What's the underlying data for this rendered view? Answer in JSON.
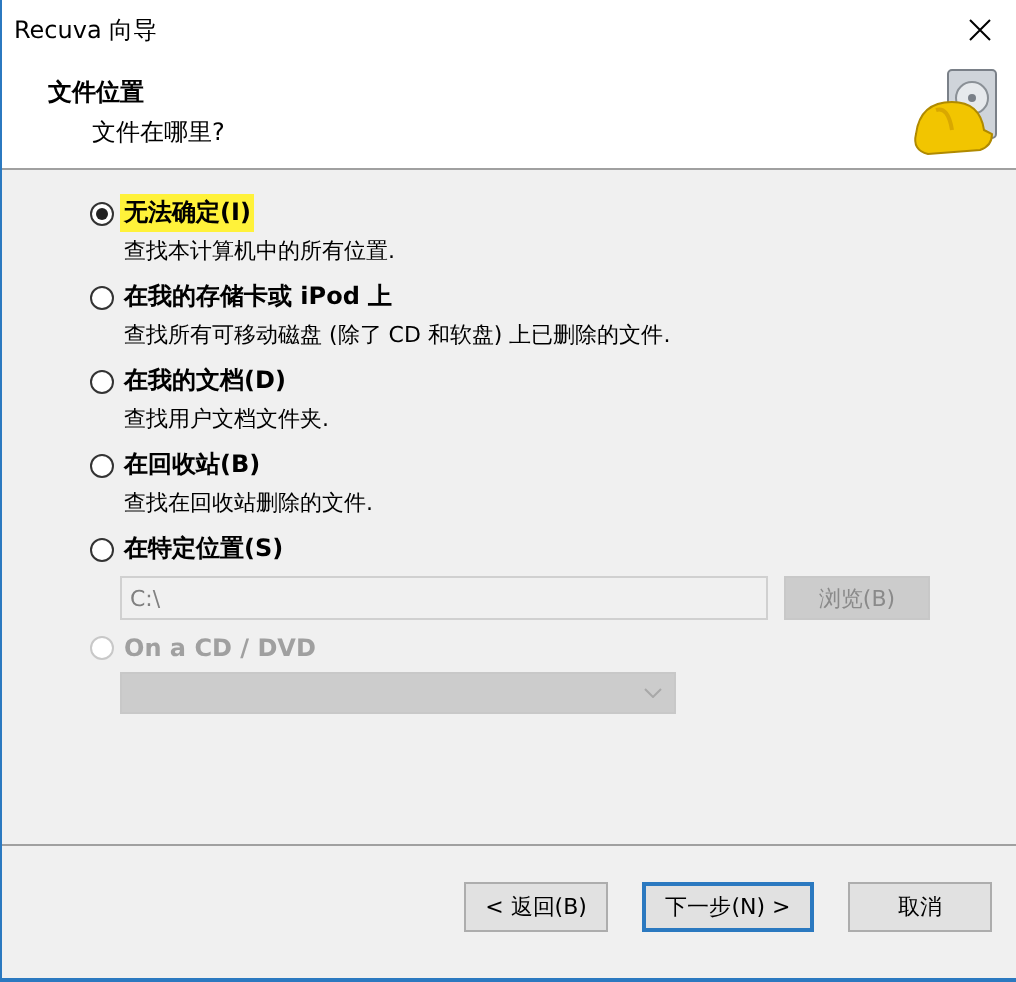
{
  "window": {
    "title": "Recuva 向导"
  },
  "header": {
    "title": "文件位置",
    "subtitle": "文件在哪里?"
  },
  "options": [
    {
      "label": "无法确定(I)",
      "description": "查找本计算机中的所有位置.",
      "selected": true,
      "disabled": false,
      "highlighted": true
    },
    {
      "label": "在我的存储卡或 iPod 上",
      "description": "查找所有可移动磁盘 (除了 CD 和软盘) 上已删除的文件.",
      "selected": false,
      "disabled": false,
      "highlighted": false
    },
    {
      "label": "在我的文档(D)",
      "description": "查找用户文档文件夹.",
      "selected": false,
      "disabled": false,
      "highlighted": false
    },
    {
      "label": "在回收站(B)",
      "description": "查找在回收站删除的文件.",
      "selected": false,
      "disabled": false,
      "highlighted": false
    },
    {
      "label": "在特定位置(S)",
      "selected": false,
      "disabled": false,
      "highlighted": false,
      "path": {
        "value": "C:\\",
        "disabled": true
      },
      "browse": {
        "label": "浏览(B)",
        "disabled": true
      }
    },
    {
      "label": "On a CD / DVD",
      "selected": false,
      "disabled": true,
      "highlighted": false,
      "dropdown": {
        "disabled": true
      }
    }
  ],
  "buttons": [
    {
      "label": "< 返回(B)",
      "default": false
    },
    {
      "label": "下一步(N) >",
      "default": true
    },
    {
      "label": "取消",
      "default": false
    }
  ]
}
